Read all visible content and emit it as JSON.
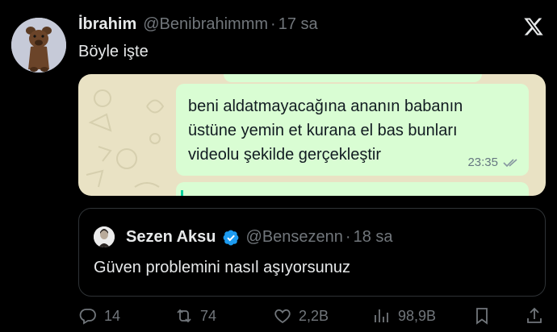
{
  "author": {
    "name": "İbrahim",
    "handle": "@Benibrahimmm",
    "separator": "·",
    "time": "17 sa"
  },
  "tweet": {
    "text": "Böyle işte"
  },
  "media": {
    "message_text": "beni aldatmayacağına ananın babanın\nüstüne yemin et kurana el bas bunları\nvideolu şekilde gerçekleştir",
    "message_time": "23:35"
  },
  "quote": {
    "name": "Sezen Aksu",
    "handle": "@Bensezenn",
    "separator": "·",
    "time": "18 sa",
    "text": "Güven problemini nasıl aşıyorsunuz"
  },
  "actions": {
    "replies": "14",
    "reposts": "74",
    "likes": "2,2B",
    "views": "98,9B"
  },
  "colors": {
    "background": "#000000",
    "text": "#e7e9ea",
    "muted": "#71767b",
    "verified": "#1d9bf0",
    "bubble": "#d9fdd3"
  },
  "icons": [
    "x-logo-icon",
    "verified-icon",
    "reply-icon",
    "repost-icon",
    "like-icon",
    "views-icon",
    "bookmark-icon",
    "share-icon"
  ]
}
